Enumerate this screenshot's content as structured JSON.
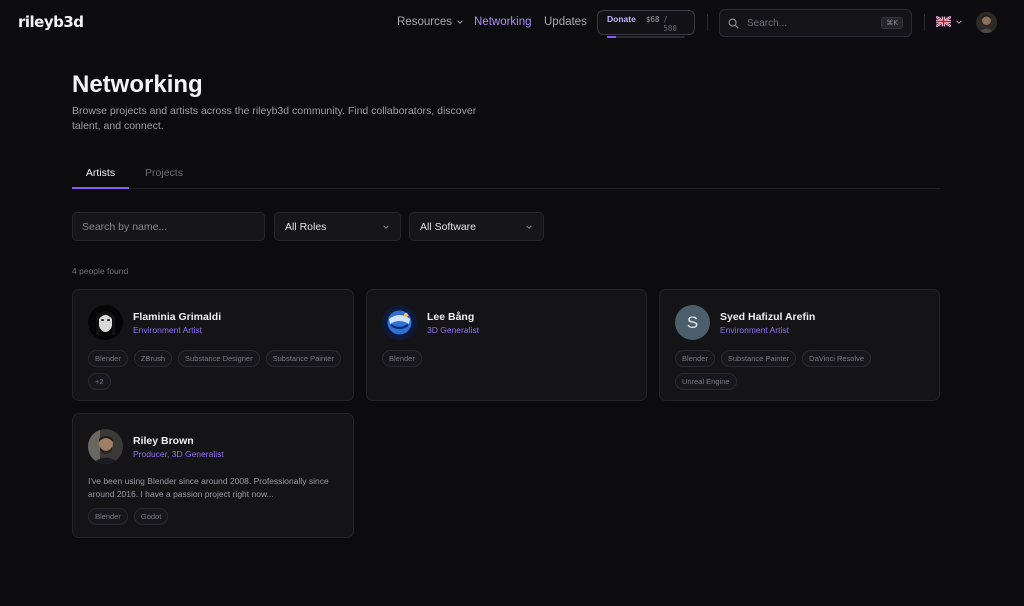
{
  "brand": {
    "logo_text": "rileyb3d"
  },
  "nav": {
    "resources_label": "Resources",
    "networking_label": "Networking",
    "updates_label": "Updates"
  },
  "donate": {
    "label": "Donate",
    "amount": "$68",
    "goal": "/ 580",
    "progress_fraction": 0.117,
    "accent_color": "#8b5cf6"
  },
  "search": {
    "placeholder": "Search...",
    "shortcut": "⌘K"
  },
  "language": {
    "icon": "uk-flag-icon"
  },
  "page": {
    "title": "Networking",
    "description": "Browse projects and artists across the rileyb3d community. Find collaborators, discover talent, and connect."
  },
  "tabs": [
    {
      "label": "Artists",
      "active": true
    },
    {
      "label": "Projects",
      "active": false
    }
  ],
  "filters": {
    "name_placeholder": "Search by name...",
    "roles_value": "All Roles",
    "software_value": "All Software"
  },
  "results": {
    "count_text": "4 people found"
  },
  "artists": [
    {
      "name": "Flaminia Grimaldi",
      "role": "Environment Artist",
      "bio": "",
      "tags": [
        "Blender",
        "ZBrush",
        "Substance Designer",
        "Substance Painter",
        "+2"
      ]
    },
    {
      "name": "Lee Bång",
      "role": "3D Generalist",
      "bio": "",
      "tags": [
        "Blender"
      ]
    },
    {
      "name": "Syed Hafizul Arefin",
      "role": "Environment Artist",
      "initial": "S",
      "bio": "",
      "tags": [
        "Blender",
        "Substance Painter",
        "DaVinci Resolve",
        "Unreal Engine"
      ]
    },
    {
      "name": "Riley Brown",
      "role": "Producer, 3D Generalist",
      "bio": "I've been using Blender since around 2008. Professionally since around 2016. I have a passion project right now...",
      "tags": [
        "Blender",
        "Godot"
      ]
    }
  ],
  "colors": {
    "accent": "#8b5cf6",
    "role_text": "#8b6ff0",
    "background": "#0c0c0e"
  }
}
